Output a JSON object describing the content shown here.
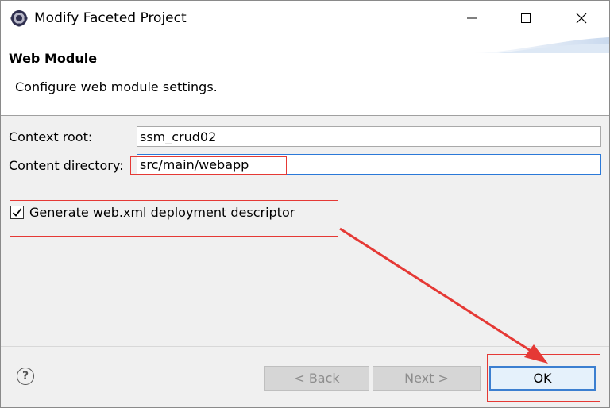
{
  "window": {
    "title": "Modify Faceted Project",
    "app_icon": "eclipse-gear-icon",
    "controls": {
      "minimize": "minimize-icon",
      "maximize": "maximize-icon",
      "close": "close-icon"
    }
  },
  "header": {
    "title": "Web Module",
    "description": "Configure web module settings."
  },
  "form": {
    "context_root_label": "Context root:",
    "context_root_value": "ssm_crud02",
    "content_dir_label": "Content directory:",
    "content_dir_value": "src/main/webapp",
    "generate_label": "Generate web.xml deployment descriptor",
    "generate_checked": true
  },
  "footer": {
    "help_icon": "help-icon",
    "back_label": "< Back",
    "next_label": "Next >",
    "ok_label": "OK"
  },
  "annotation": {
    "color": "#e53935"
  }
}
